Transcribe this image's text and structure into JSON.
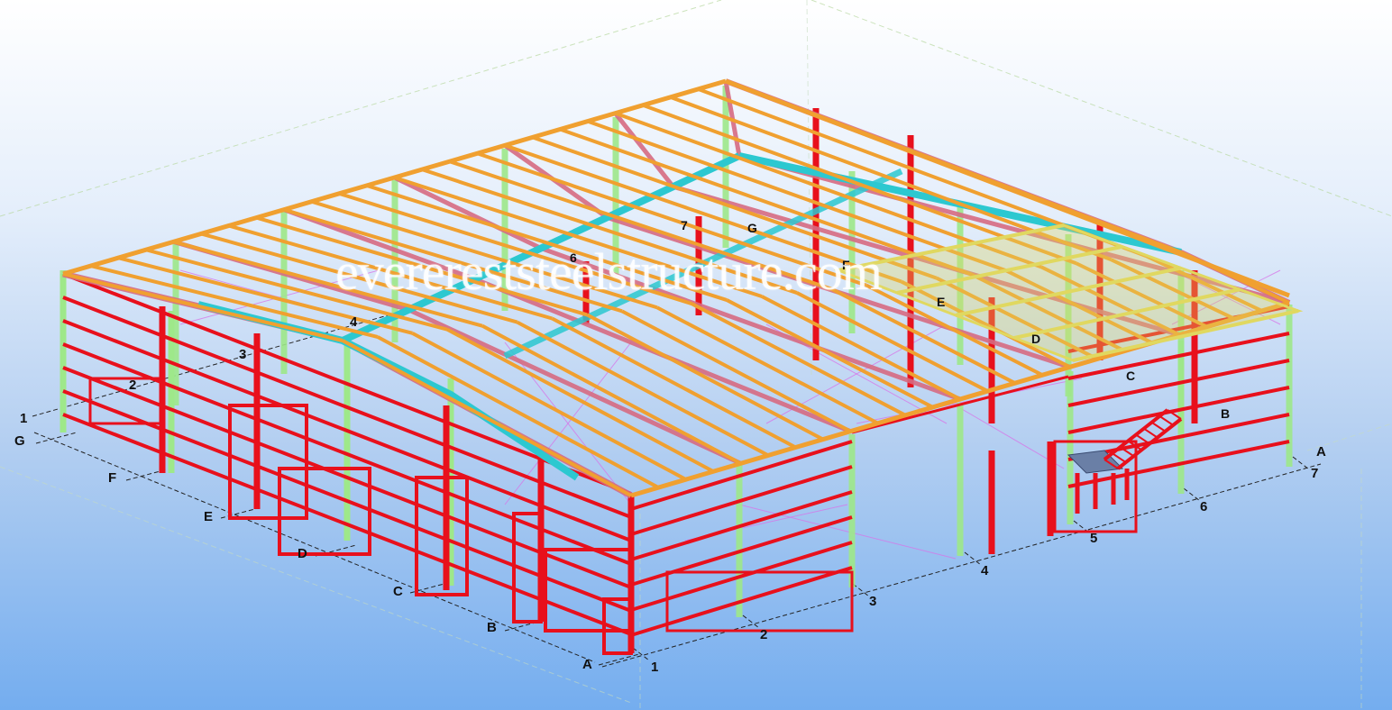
{
  "watermark": "everereststeelstructure.com",
  "colors": {
    "column": "#e8101c",
    "wall_girt": "#e8101c",
    "gable_post": "#9ee88a",
    "roof_purlin": "#f0a030",
    "rafter": "#d66a82",
    "ridge_beam": "#2cc8d0",
    "bracing": "#d873e8",
    "mezzanine": "#e0d860",
    "grid_line": "#222222"
  },
  "icons": {
    "stair": "stair-icon",
    "mezzanine": "mezzanine-icon"
  },
  "grid_labels": {
    "left_numbers": [
      "1",
      "2",
      "3",
      "4"
    ],
    "left_letters": [
      "G",
      "F",
      "E",
      "D",
      "C",
      "B",
      "A"
    ],
    "front_numbers": [
      "1",
      "2",
      "3",
      "4",
      "5",
      "6",
      "7"
    ],
    "right_letter": "A",
    "inner_numbers": [
      "6",
      "7"
    ],
    "inner_letters": [
      "G",
      "F",
      "E",
      "D",
      "C",
      "B"
    ]
  }
}
